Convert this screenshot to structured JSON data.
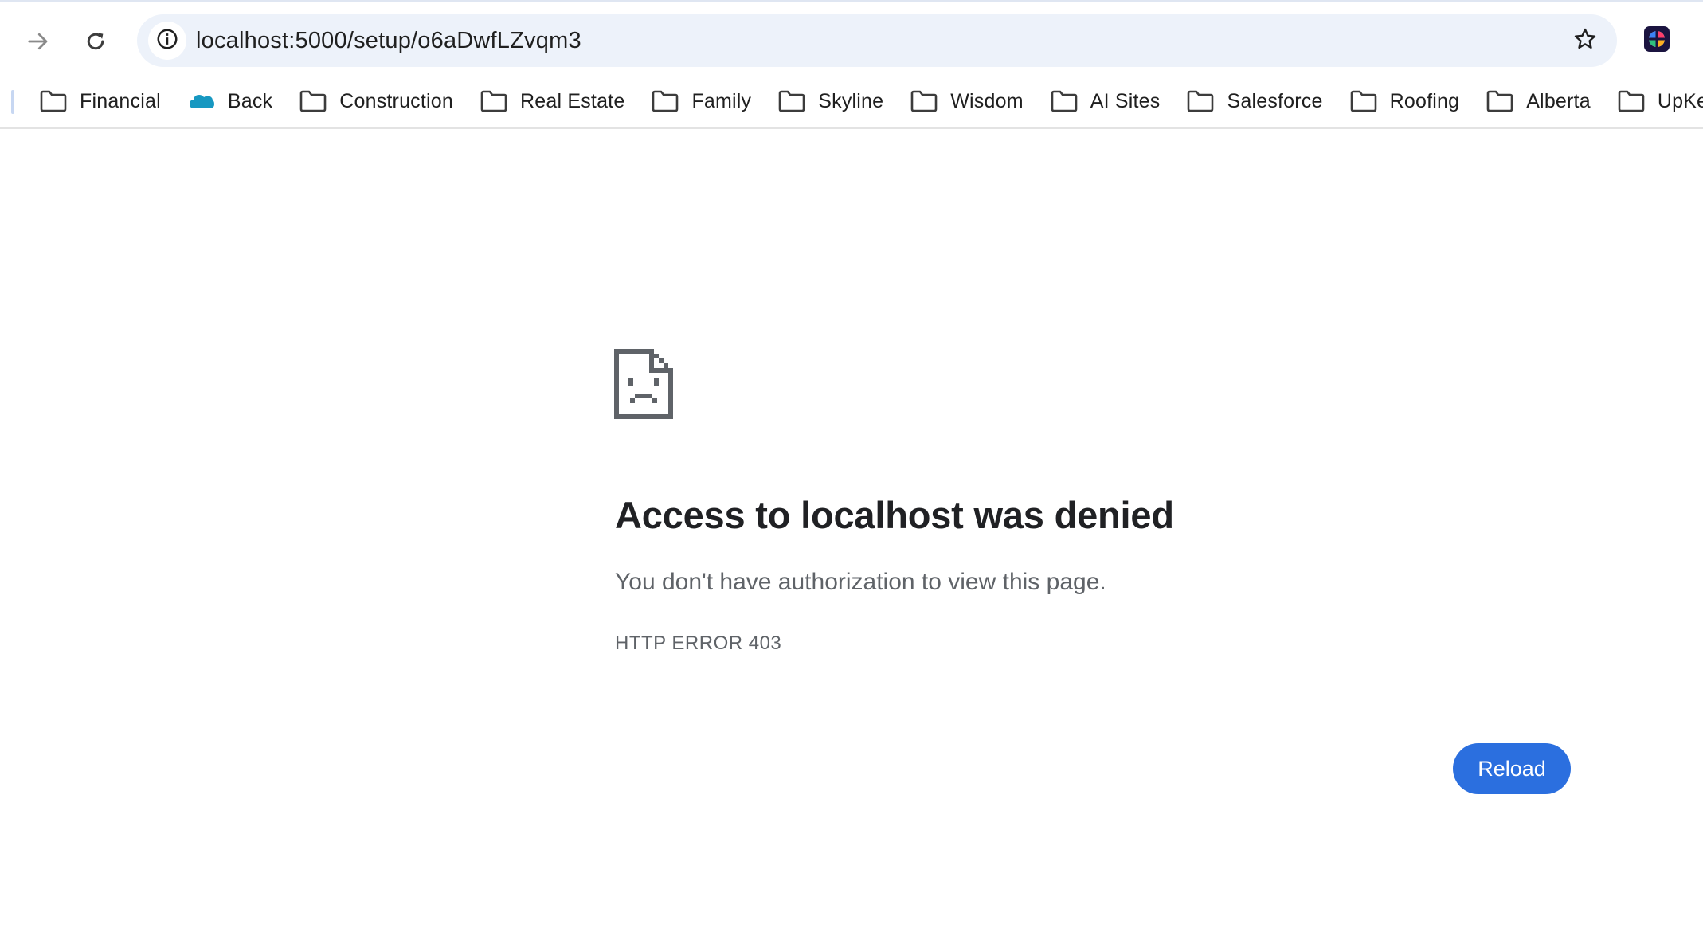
{
  "browser": {
    "url": "localhost:5000/setup/o6aDwfLZvqm3",
    "icons": {
      "forward": "arrow-right-icon",
      "reload": "reload-icon",
      "site_info": "info-circle-icon",
      "bookmark_star": "star-outline-icon",
      "extension": "colorful-extension-icon"
    },
    "colors": {
      "omnibox_bg": "#edf2fa",
      "accent": "#2b6fdf",
      "salesforce_cloud": "#1798c1"
    }
  },
  "bookmarks": [
    {
      "label": "Financial",
      "icon": "folder-icon"
    },
    {
      "label": "Back",
      "icon": "salesforce-cloud-icon"
    },
    {
      "label": "Construction",
      "icon": "folder-icon"
    },
    {
      "label": "Real Estate",
      "icon": "folder-icon"
    },
    {
      "label": "Family",
      "icon": "folder-icon"
    },
    {
      "label": "Skyline",
      "icon": "folder-icon"
    },
    {
      "label": "Wisdom",
      "icon": "folder-icon"
    },
    {
      "label": "AI Sites",
      "icon": "folder-icon"
    },
    {
      "label": "Salesforce",
      "icon": "folder-icon"
    },
    {
      "label": "Roofing",
      "icon": "folder-icon"
    },
    {
      "label": "Alberta",
      "icon": "folder-icon"
    },
    {
      "label": "UpKe",
      "icon": "folder-icon"
    }
  ],
  "error": {
    "icon": "sad-document-icon",
    "title": "Access to localhost was denied",
    "description": "You don't have authorization to view this page.",
    "code": "HTTP ERROR 403",
    "reload_label": "Reload"
  }
}
